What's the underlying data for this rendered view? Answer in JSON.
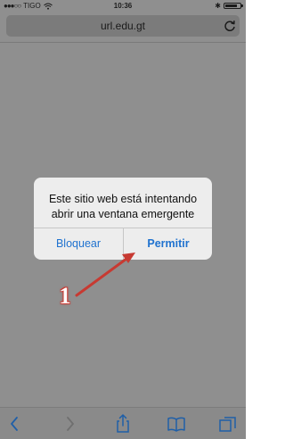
{
  "status_bar": {
    "carrier": "TIGO",
    "signal_dots": "●●●○○",
    "time": "10:36",
    "battery_level": 0.8
  },
  "url_bar": {
    "url": "url.edu.gt"
  },
  "dialog": {
    "message": "Este sitio web está intentando abrir una ventana emergente",
    "block_label": "Bloquear",
    "allow_label": "Permitir"
  },
  "annotation": {
    "label": "1",
    "color": "#c73a32"
  },
  "toolbar": {
    "items": [
      "back-icon",
      "forward-icon",
      "share-icon",
      "bookmarks-icon",
      "tabs-icon"
    ]
  },
  "colors": {
    "accent": "#1f72cf",
    "dimmed_background": "#8f8f8f"
  }
}
